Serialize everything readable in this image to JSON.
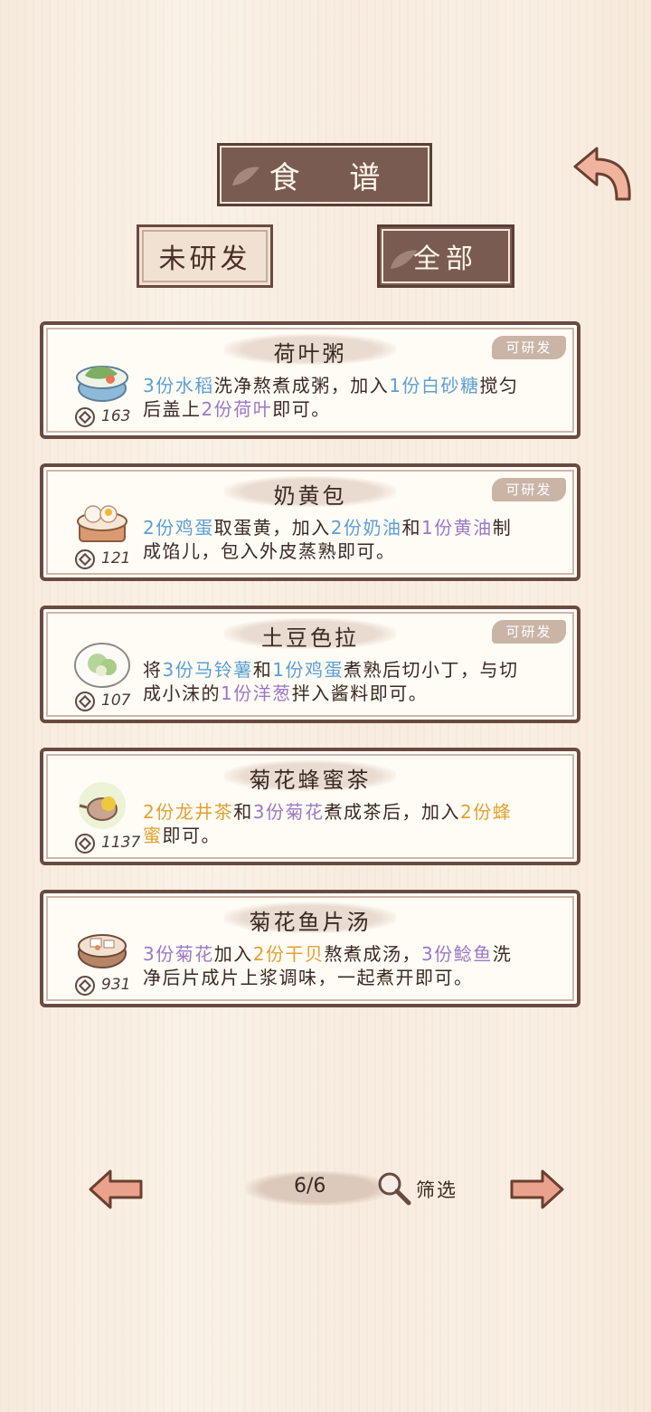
{
  "header": {
    "title": "食 谱"
  },
  "tabs": {
    "undeveloped": "未研发",
    "all": "全部"
  },
  "badge_label": "可研发",
  "recipes": [
    {
      "name": "荷叶粥",
      "price": "163",
      "badge": true,
      "icon": "lotus-porridge-icon",
      "lines": [
        [
          {
            "t": "3份水稻",
            "c": "blue"
          },
          {
            "t": "洗净熬煮成粥，加入"
          },
          {
            "t": "1份白砂糖",
            "c": "blue"
          },
          {
            "t": "搅匀"
          }
        ],
        [
          {
            "t": "后盖上"
          },
          {
            "t": "2份荷叶",
            "c": "purple"
          },
          {
            "t": "即可。"
          }
        ]
      ]
    },
    {
      "name": "奶黄包",
      "price": "121",
      "badge": true,
      "icon": "custard-bun-icon",
      "lines": [
        [
          {
            "t": "2份鸡蛋",
            "c": "blue"
          },
          {
            "t": "取蛋黄，加入"
          },
          {
            "t": "2份奶油",
            "c": "blue"
          },
          {
            "t": "和"
          },
          {
            "t": "1份黄油",
            "c": "purple"
          },
          {
            "t": "制"
          }
        ],
        [
          {
            "t": "成馅儿，包入外皮蒸熟即可。"
          }
        ]
      ]
    },
    {
      "name": "土豆色拉",
      "price": "107",
      "badge": true,
      "icon": "potato-salad-icon",
      "lines": [
        [
          {
            "t": "将"
          },
          {
            "t": "3份马铃薯",
            "c": "blue"
          },
          {
            "t": "和"
          },
          {
            "t": "1份鸡蛋",
            "c": "blue"
          },
          {
            "t": "煮熟后切小丁，与切"
          }
        ],
        [
          {
            "t": "成小沫的"
          },
          {
            "t": "1份洋葱",
            "c": "purple"
          },
          {
            "t": "拌入酱料即可。"
          }
        ]
      ]
    },
    {
      "name": "菊花蜂蜜茶",
      "price": "1137",
      "badge": false,
      "icon": "chrysanthemum-tea-icon",
      "lines": [
        [
          {
            "t": "2份龙井茶",
            "c": "gold"
          },
          {
            "t": "和"
          },
          {
            "t": "3份菊花",
            "c": "purple"
          },
          {
            "t": "煮成茶后，加入"
          },
          {
            "t": "2份蜂",
            "c": "gold"
          }
        ],
        [
          {
            "t": "蜜",
            "c": "gold"
          },
          {
            "t": "即可。"
          }
        ]
      ]
    },
    {
      "name": "菊花鱼片汤",
      "price": "931",
      "badge": false,
      "icon": "fish-soup-icon",
      "lines": [
        [
          {
            "t": "3份菊花",
            "c": "purple"
          },
          {
            "t": "加入"
          },
          {
            "t": "2份干贝",
            "c": "gold"
          },
          {
            "t": "熬煮成汤，"
          },
          {
            "t": "3份鲶鱼",
            "c": "purple"
          },
          {
            "t": "洗"
          }
        ],
        [
          {
            "t": "净后片成片上浆调味，一起煮开即可。"
          }
        ]
      ]
    }
  ],
  "pager": {
    "page": "6/6",
    "filter_label": "筛选"
  },
  "colors": {
    "blue": "#5b9fd4",
    "purple": "#9a79c8",
    "gold": "#e0a232",
    "frame": "#6a4a40",
    "banner": "#7a5b52"
  }
}
